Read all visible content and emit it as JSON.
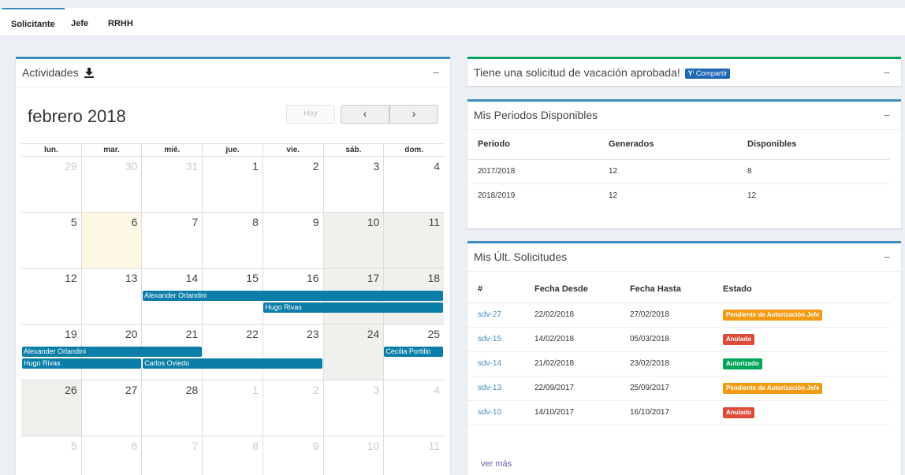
{
  "tabs": [
    {
      "label": "Solicitante",
      "active": true
    },
    {
      "label": "Jefe"
    },
    {
      "label": "RRHH"
    }
  ],
  "calendar": {
    "box_title": "Actividades",
    "month_title": "febrero 2018",
    "today_label": "Hoy",
    "prev_label": "‹",
    "next_label": "›",
    "dow": [
      "lun.",
      "mar.",
      "mié.",
      "jue.",
      "vie.",
      "sáb.",
      "dom."
    ],
    "weeks": [
      [
        {
          "n": "29",
          "other": true
        },
        {
          "n": "30",
          "other": true
        },
        {
          "n": "31",
          "other": true
        },
        {
          "n": "1"
        },
        {
          "n": "2"
        },
        {
          "n": "3"
        },
        {
          "n": "4"
        }
      ],
      [
        {
          "n": "5"
        },
        {
          "n": "6",
          "today": true
        },
        {
          "n": "7"
        },
        {
          "n": "8"
        },
        {
          "n": "9"
        },
        {
          "n": "10",
          "weekend": true
        },
        {
          "n": "11",
          "weekend": true
        }
      ],
      [
        {
          "n": "12"
        },
        {
          "n": "13"
        },
        {
          "n": "14"
        },
        {
          "n": "15"
        },
        {
          "n": "16"
        },
        {
          "n": "17",
          "weekend": true
        },
        {
          "n": "18",
          "weekend": true
        }
      ],
      [
        {
          "n": "19"
        },
        {
          "n": "20"
        },
        {
          "n": "21"
        },
        {
          "n": "22"
        },
        {
          "n": "23"
        },
        {
          "n": "24",
          "weekend": true
        },
        {
          "n": "25"
        }
      ],
      [
        {
          "n": "26",
          "weekend": true
        },
        {
          "n": "27"
        },
        {
          "n": "28"
        },
        {
          "n": "1",
          "other": true
        },
        {
          "n": "2",
          "other": true
        },
        {
          "n": "3",
          "other": true
        },
        {
          "n": "4",
          "other": true
        }
      ],
      [
        {
          "n": "5",
          "other": true
        },
        {
          "n": "6",
          "other": true
        },
        {
          "n": "7",
          "other": true
        },
        {
          "n": "8",
          "other": true
        },
        {
          "n": "9",
          "other": true
        },
        {
          "n": "10",
          "other": true
        },
        {
          "n": "11",
          "other": true
        }
      ]
    ],
    "events": [
      {
        "label": "Alexander Orlandini",
        "week": 2,
        "start": 2,
        "end": 7,
        "row": 0
      },
      {
        "label": "Hugo Rivas",
        "week": 2,
        "start": 4,
        "end": 7,
        "row": 1
      },
      {
        "label": "Alexander Orlandini",
        "week": 3,
        "start": 0,
        "end": 3,
        "row": 0
      },
      {
        "label": "Cecilia Portillo",
        "week": 3,
        "start": 6,
        "end": 7,
        "row": 0
      },
      {
        "label": "Hugo Rivas",
        "week": 3,
        "start": 0,
        "end": 2,
        "row": 1
      },
      {
        "label": "Carlos Oviedo",
        "week": 3,
        "start": 2,
        "end": 5,
        "row": 1
      }
    ]
  },
  "approved": {
    "title": "Tiene una solicitud de vacación aprobada!",
    "share_label": "Compartir"
  },
  "periods": {
    "title": "Mis Periodos Disponibles",
    "headers": [
      "Periodo",
      "Generados",
      "Disponibles"
    ],
    "rows": [
      [
        "2017/2018",
        "12",
        "8"
      ],
      [
        "2018/2019",
        "12",
        "12"
      ]
    ]
  },
  "requests": {
    "title": "Mis Últ. Solicitudes",
    "headers": [
      "#",
      "Fecha Desde",
      "Fecha Hasta",
      "Estado"
    ],
    "rows": [
      {
        "id": "sdv-27",
        "desde": "22/02/2018",
        "hasta": "27/02/2018",
        "estado": "Pendiente de Autorización Jefe",
        "color": "#f39c12"
      },
      {
        "id": "sdv-15",
        "desde": "14/02/2018",
        "hasta": "05/03/2018",
        "estado": "Anulado",
        "color": "#dd4b39"
      },
      {
        "id": "sdv-14",
        "desde": "21/02/2018",
        "hasta": "23/02/2018",
        "estado": "Autorizado",
        "color": "#00a65a"
      },
      {
        "id": "sdv-13",
        "desde": "22/09/2017",
        "hasta": "25/09/2017",
        "estado": "Pendiente de Autorización Jefe",
        "color": "#f39c12"
      },
      {
        "id": "sdv-10",
        "desde": "14/10/2017",
        "hasta": "16/10/2017",
        "estado": "Anulado",
        "color": "#dd4b39"
      }
    ],
    "more_label": "ver más"
  }
}
